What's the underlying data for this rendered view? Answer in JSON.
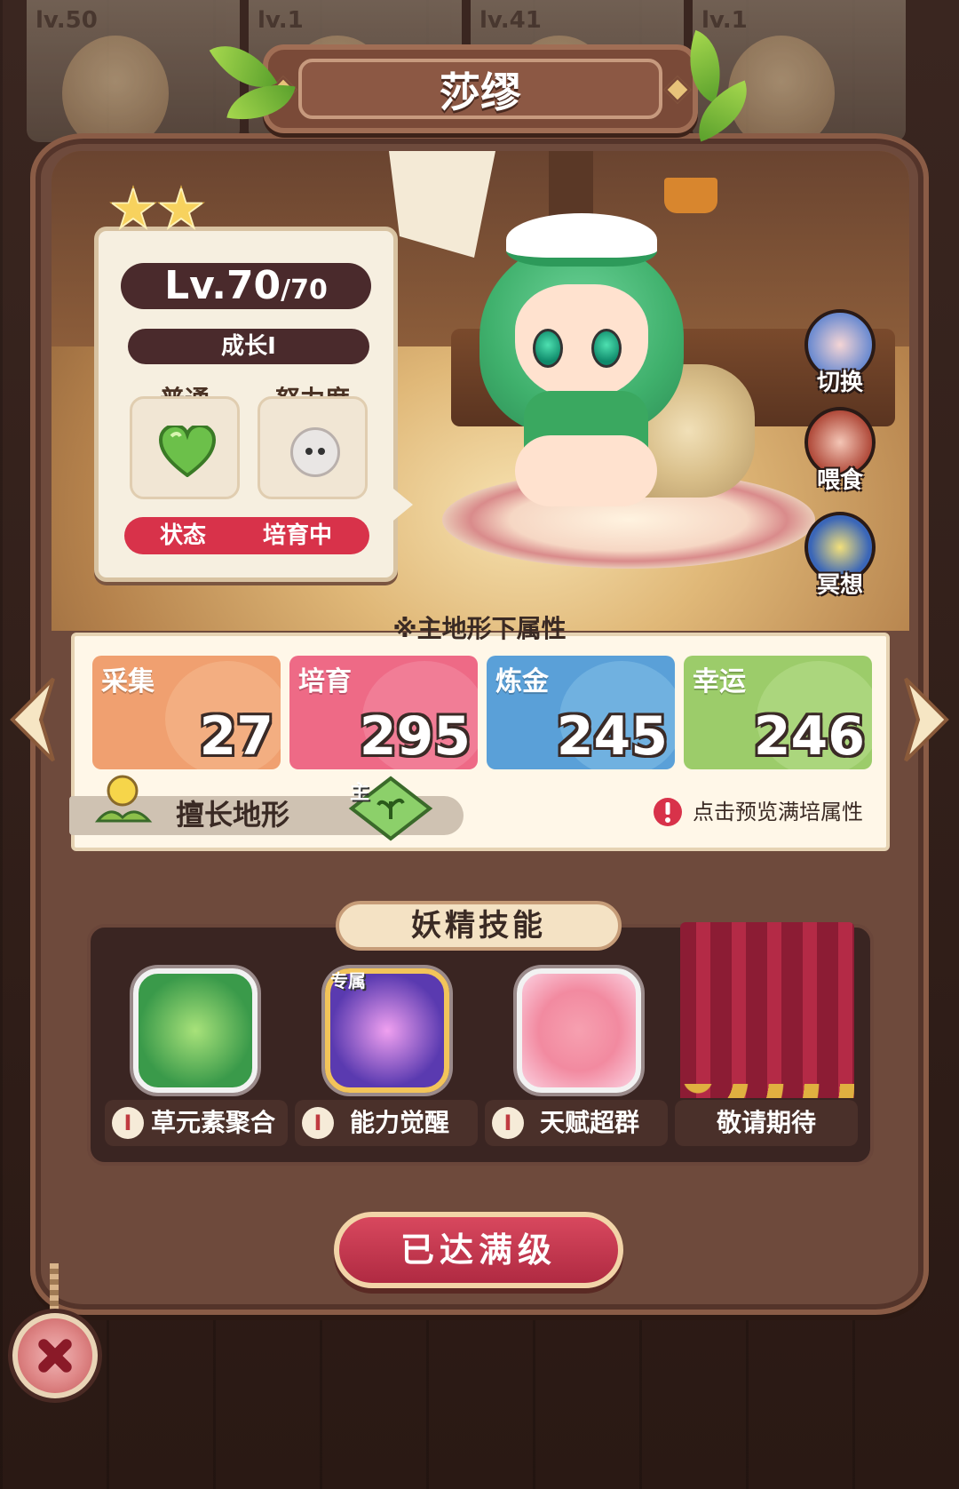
{
  "top_strip": {
    "levels": [
      "lv.50",
      "lv.1",
      "lv.41",
      "lv.1"
    ]
  },
  "character": {
    "name": "莎缪",
    "stars": 2,
    "level": "Lv.70",
    "level_max": "/70",
    "growth": "成长I",
    "type_label": "普通",
    "effort_label": "努力度",
    "status_label": "状态",
    "status_value": "培育中"
  },
  "side_actions": {
    "switch": "切换",
    "feed": "喂食",
    "meditate": "冥想"
  },
  "attributes": {
    "title": "※主地形下属性",
    "items": [
      {
        "label": "采集",
        "value": "27",
        "color": "#f0a070"
      },
      {
        "label": "培育",
        "value": "295",
        "color": "#ee6a86"
      },
      {
        "label": "炼金",
        "value": "245",
        "color": "#5aa0d8"
      },
      {
        "label": "幸运",
        "value": "246",
        "color": "#9ccc6a"
      }
    ],
    "terrain_label": "擅长地形",
    "terrain_main": "主",
    "hint": "点击预览满培属性"
  },
  "skills": {
    "title": "妖精技能",
    "items": [
      {
        "name": "草元素聚合",
        "badge": "I"
      },
      {
        "name": "能力觉醒",
        "badge": "I",
        "tag": "专属"
      },
      {
        "name": "天赋超群",
        "badge": "I"
      },
      {
        "name": "敬请期待"
      }
    ]
  },
  "max_button": "已达满级",
  "colors": {
    "frame": "#6e4a3c",
    "accent_red": "#d8324a",
    "dark_pill": "#4a2a2c"
  }
}
